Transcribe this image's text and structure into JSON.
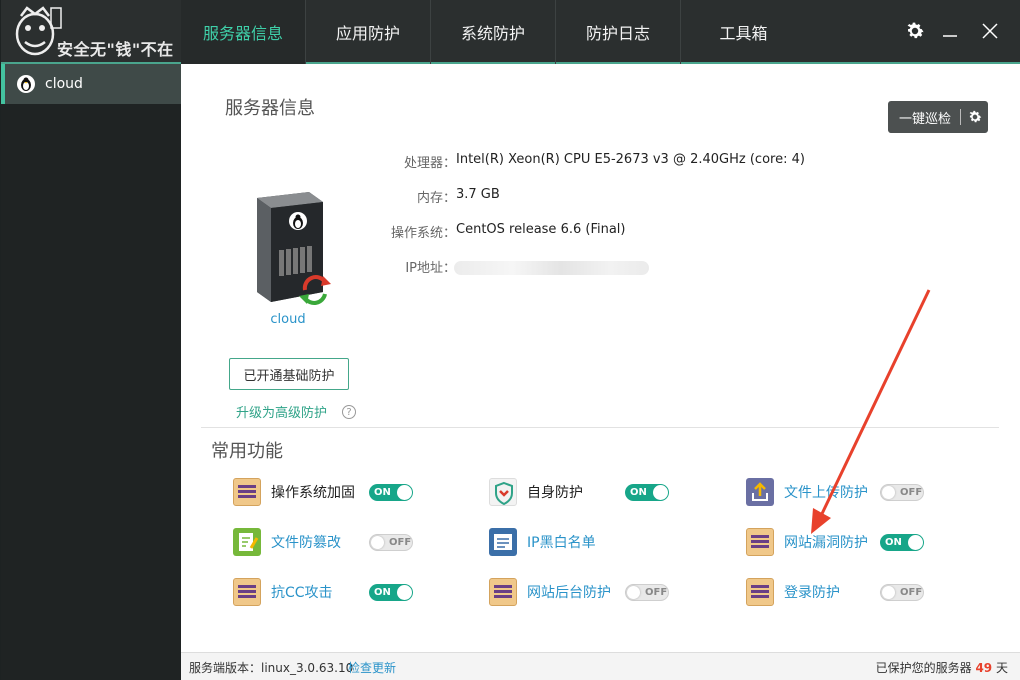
{
  "app": {
    "logo_text": "安全无\"钱\"不在"
  },
  "tabs": [
    {
      "label": "服务器信息",
      "active": true
    },
    {
      "label": "应用防护",
      "active": false
    },
    {
      "label": "系统防护",
      "active": false
    },
    {
      "label": "防护日志",
      "active": false
    },
    {
      "label": "工具箱",
      "active": false
    }
  ],
  "window_controls": {
    "settings": "gear-icon",
    "minimize": "minimize-icon",
    "close": "close-icon"
  },
  "sidebar": {
    "servers": [
      {
        "name": "cloud",
        "icon": "linux-tux-icon",
        "selected": true
      }
    ]
  },
  "server_info": {
    "title": "服务器信息",
    "patrol_button": "一键巡检",
    "server_name": "cloud",
    "cpu_label": "处理器：",
    "cpu_value": "Intel(R) Xeon(R) CPU E5-2673 v3 @ 2.40GHz (core: 4)",
    "mem_label": "内存：",
    "mem_value": "3.7 GB",
    "os_label": "操作系统：",
    "os_value": "CentOS release 6.6 (Final)",
    "ip_label": "IP地址：",
    "basic_protection_button": "已开通基础防护",
    "upgrade_link": "升级为高级防护",
    "help": "?"
  },
  "common": {
    "title": "常用功能",
    "features": [
      {
        "name": "操作系统加固",
        "state": "ON",
        "icon": "firewall-icon"
      },
      {
        "name": "自身防护",
        "state": "ON",
        "icon": "shield-icon"
      },
      {
        "name": "文件上传防护",
        "state": "OFF",
        "icon": "upload-icon"
      },
      {
        "name": "文件防篡改",
        "state": "OFF",
        "icon": "file-edit-icon"
      },
      {
        "name": "IP黑白名单",
        "state": "",
        "icon": "ip-list-icon"
      },
      {
        "name": "网站漏洞防护",
        "state": "ON",
        "icon": "firewall-icon"
      },
      {
        "name": "抗CC攻击",
        "state": "ON",
        "icon": "firewall-icon"
      },
      {
        "name": "网站后台防护",
        "state": "OFF",
        "icon": "firewall-icon"
      },
      {
        "name": "登录防护",
        "state": "OFF",
        "icon": "firewall-icon"
      }
    ]
  },
  "footer": {
    "version_label": "服务端版本：linux_3.0.63.10",
    "check_update": "检查更新",
    "protected_prefix": "已保护您的服务器",
    "protected_days": "49",
    "protected_suffix": "天"
  },
  "colors": {
    "accent": "#3fd0a9",
    "topbar": "#2b2f2f",
    "toggle_on": "#17a689",
    "link": "#2a93c9",
    "annotation_arrow": "#e8412c"
  }
}
